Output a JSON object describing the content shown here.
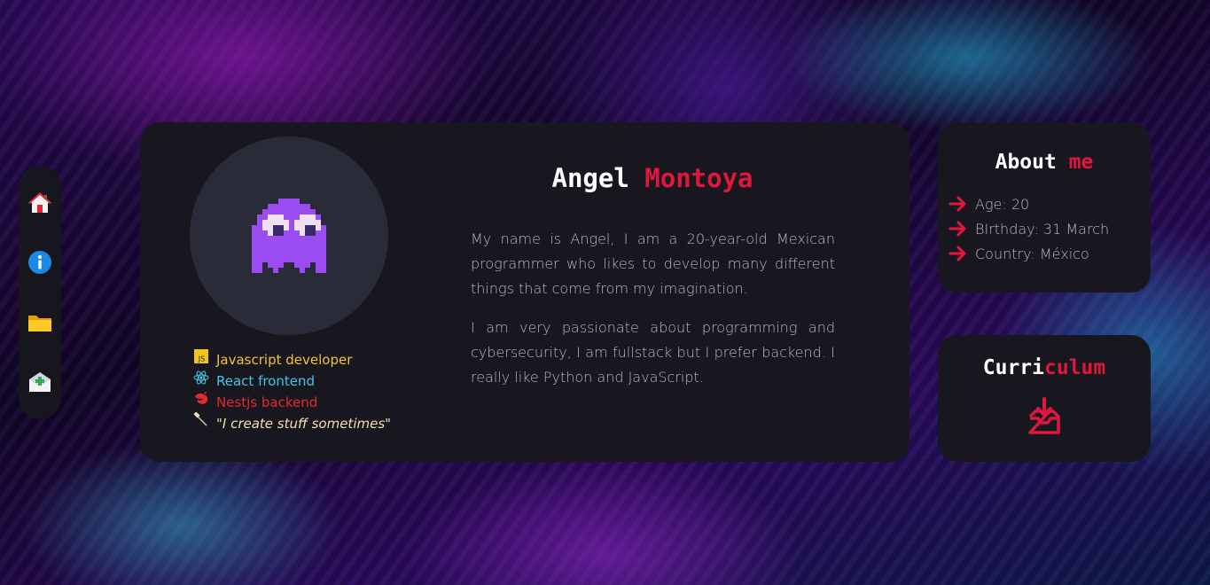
{
  "nav": {
    "items": [
      {
        "name": "home",
        "icon": "house-icon"
      },
      {
        "name": "info",
        "icon": "info-icon"
      },
      {
        "name": "projects",
        "icon": "folder-icon"
      },
      {
        "name": "contact",
        "icon": "envelope-icon"
      }
    ]
  },
  "profile": {
    "avatar_icon": "pixel-ghost-icon",
    "first_name": "Angel",
    "last_name": "Montoya",
    "skills": [
      {
        "icon": "js-icon",
        "label": "Javascript developer",
        "color": "#f2c230"
      },
      {
        "icon": "react-icon",
        "label": "React frontend",
        "color": "#44c6e8"
      },
      {
        "icon": "nestjs-icon",
        "label": "Nestjs backend",
        "color": "#e02a30"
      },
      {
        "icon": "pin-icon",
        "label": "\"I create stuff sometimes\"",
        "color": "#f3dfb0"
      }
    ],
    "bio": [
      "My name is Angel, I am a 20-year-old Mexican programmer who likes to develop many different things that come from my imagination.",
      "I am very passionate about programming and cybersecurity, I am fullstack but I prefer backend. I really like Python and JavaScript."
    ]
  },
  "about": {
    "title_main": "About",
    "title_accent": "me",
    "items": [
      {
        "icon": "arrow-right-icon",
        "text": "Age: 20"
      },
      {
        "icon": "arrow-right-icon",
        "text": "BIrthday: 31 March"
      },
      {
        "icon": "arrow-right-icon",
        "text": "Country: México"
      }
    ]
  },
  "curriculum": {
    "title_main": "Curri",
    "title_accent": "culum",
    "icon": "download-tray-icon"
  },
  "colors": {
    "accent": "#e0173d",
    "card_bg": "#18171f",
    "text_muted": "#b8b8c2"
  }
}
